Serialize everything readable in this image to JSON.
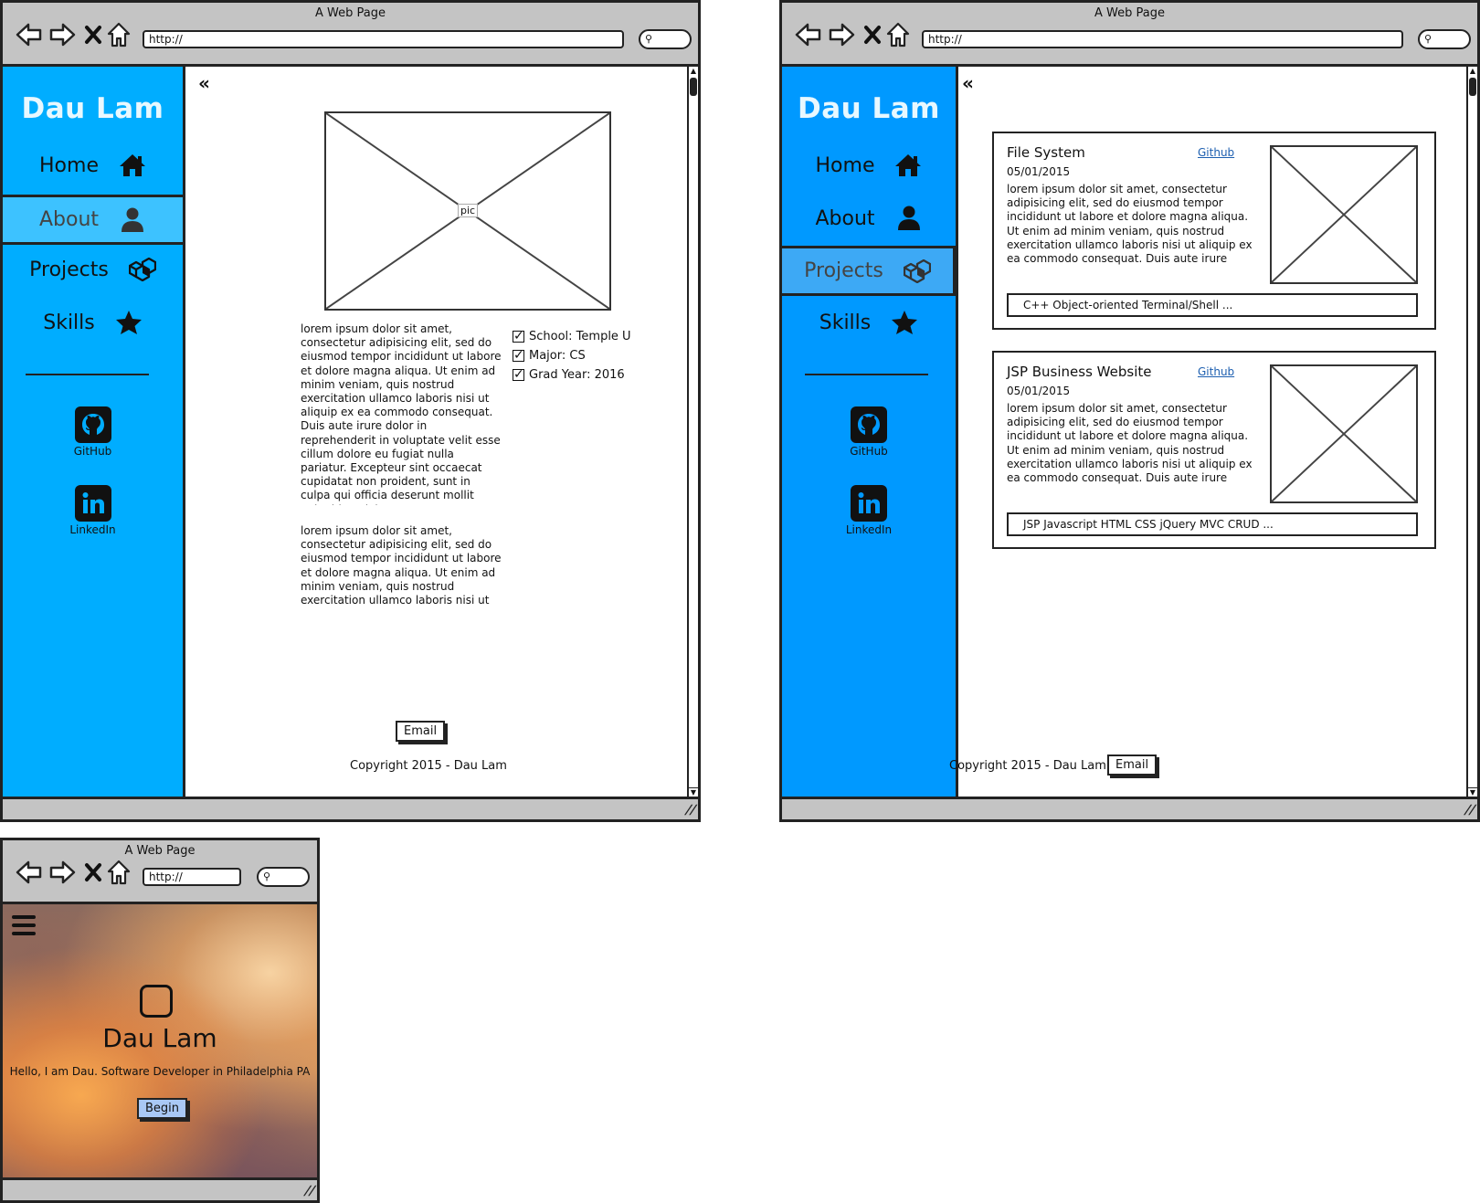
{
  "browser": {
    "title": "A Web Page",
    "url": "http://"
  },
  "colors": {
    "sidebar_about": "#00adff",
    "sidebar_projects": "#0099ff",
    "active_item": "#3dc2ff",
    "chrome": "#c4c4c4"
  },
  "sidebar": {
    "brand": "Dau Lam",
    "items": [
      {
        "label": "Home",
        "icon": "home-icon"
      },
      {
        "label": "About",
        "icon": "user-icon"
      },
      {
        "label": "Projects",
        "icon": "cubes-icon"
      },
      {
        "label": "Skills",
        "icon": "star-icon"
      }
    ],
    "social": [
      {
        "label": "GitHub",
        "icon": "github-icon"
      },
      {
        "label": "LinkedIn",
        "icon": "linkedin-icon"
      }
    ]
  },
  "about": {
    "image_label": "pic",
    "paragraph1": "lorem ipsum dolor sit amet, consectetur adipisicing elit, sed do eiusmod tempor incididunt ut labore et dolore magna aliqua. Ut enim ad minim veniam, quis nostrud exercitation ullamco laboris nisi ut aliquip ex ea commodo consequat. Duis aute irure dolor in reprehenderit in voluptate velit esse cillum dolore eu fugiat nulla pariatur. Excepteur sint occaecat cupidatat non proident, sunt in culpa qui officia deserunt mollit anim id est laborum.",
    "paragraph2": "lorem ipsum dolor sit amet, consectetur adipisicing elit, sed do eiusmod tempor incididunt ut labore et dolore magna aliqua. Ut enim ad minim veniam, quis nostrud exercitation ullamco laboris nisi ut aliquip ex ea commodo consequat.",
    "facts": [
      "School: Temple U",
      "Major: CS",
      "Grad Year: 2016"
    ],
    "email_label": "Email",
    "copyright": "Copyright 2015 - Dau Lam"
  },
  "projects": {
    "items": [
      {
        "title": "File System",
        "link": "Github",
        "date": "05/01/2015",
        "description": "lorem ipsum dolor sit amet, consectetur adipisicing elit, sed do eiusmod tempor incididunt ut labore et dolore magna aliqua. Ut enim ad minim veniam, quis nostrud exercitation ullamco laboris nisi ut aliquip ex ea commodo consequat. Duis aute irure dolor in reprehenderit in voluptate velit esse cillum",
        "tags": "C++ Object-oriented Terminal/Shell      ..."
      },
      {
        "title": "JSP Business Website",
        "link": "Github",
        "date": "05/01/2015",
        "description": "lorem ipsum dolor sit amet, consectetur adipisicing elit, sed do eiusmod tempor incididunt ut labore et dolore magna aliqua. Ut enim ad minim veniam, quis nostrud exercitation ullamco laboris nisi ut aliquip ex ea commodo consequat. Duis aute irure dolor in reprehenderit in voluptate velit esse cillum",
        "tags": "JSP Javascript HTML CSS jQuery MVC CRUD      ..."
      }
    ],
    "copyright": "Copyright 2015 - Dau Lam",
    "email_label": "Email"
  },
  "landing": {
    "name": "Dau Lam",
    "tagline": "Hello, I am Dau. Software Developer in Philadelphia PA",
    "begin_label": "Begin"
  }
}
